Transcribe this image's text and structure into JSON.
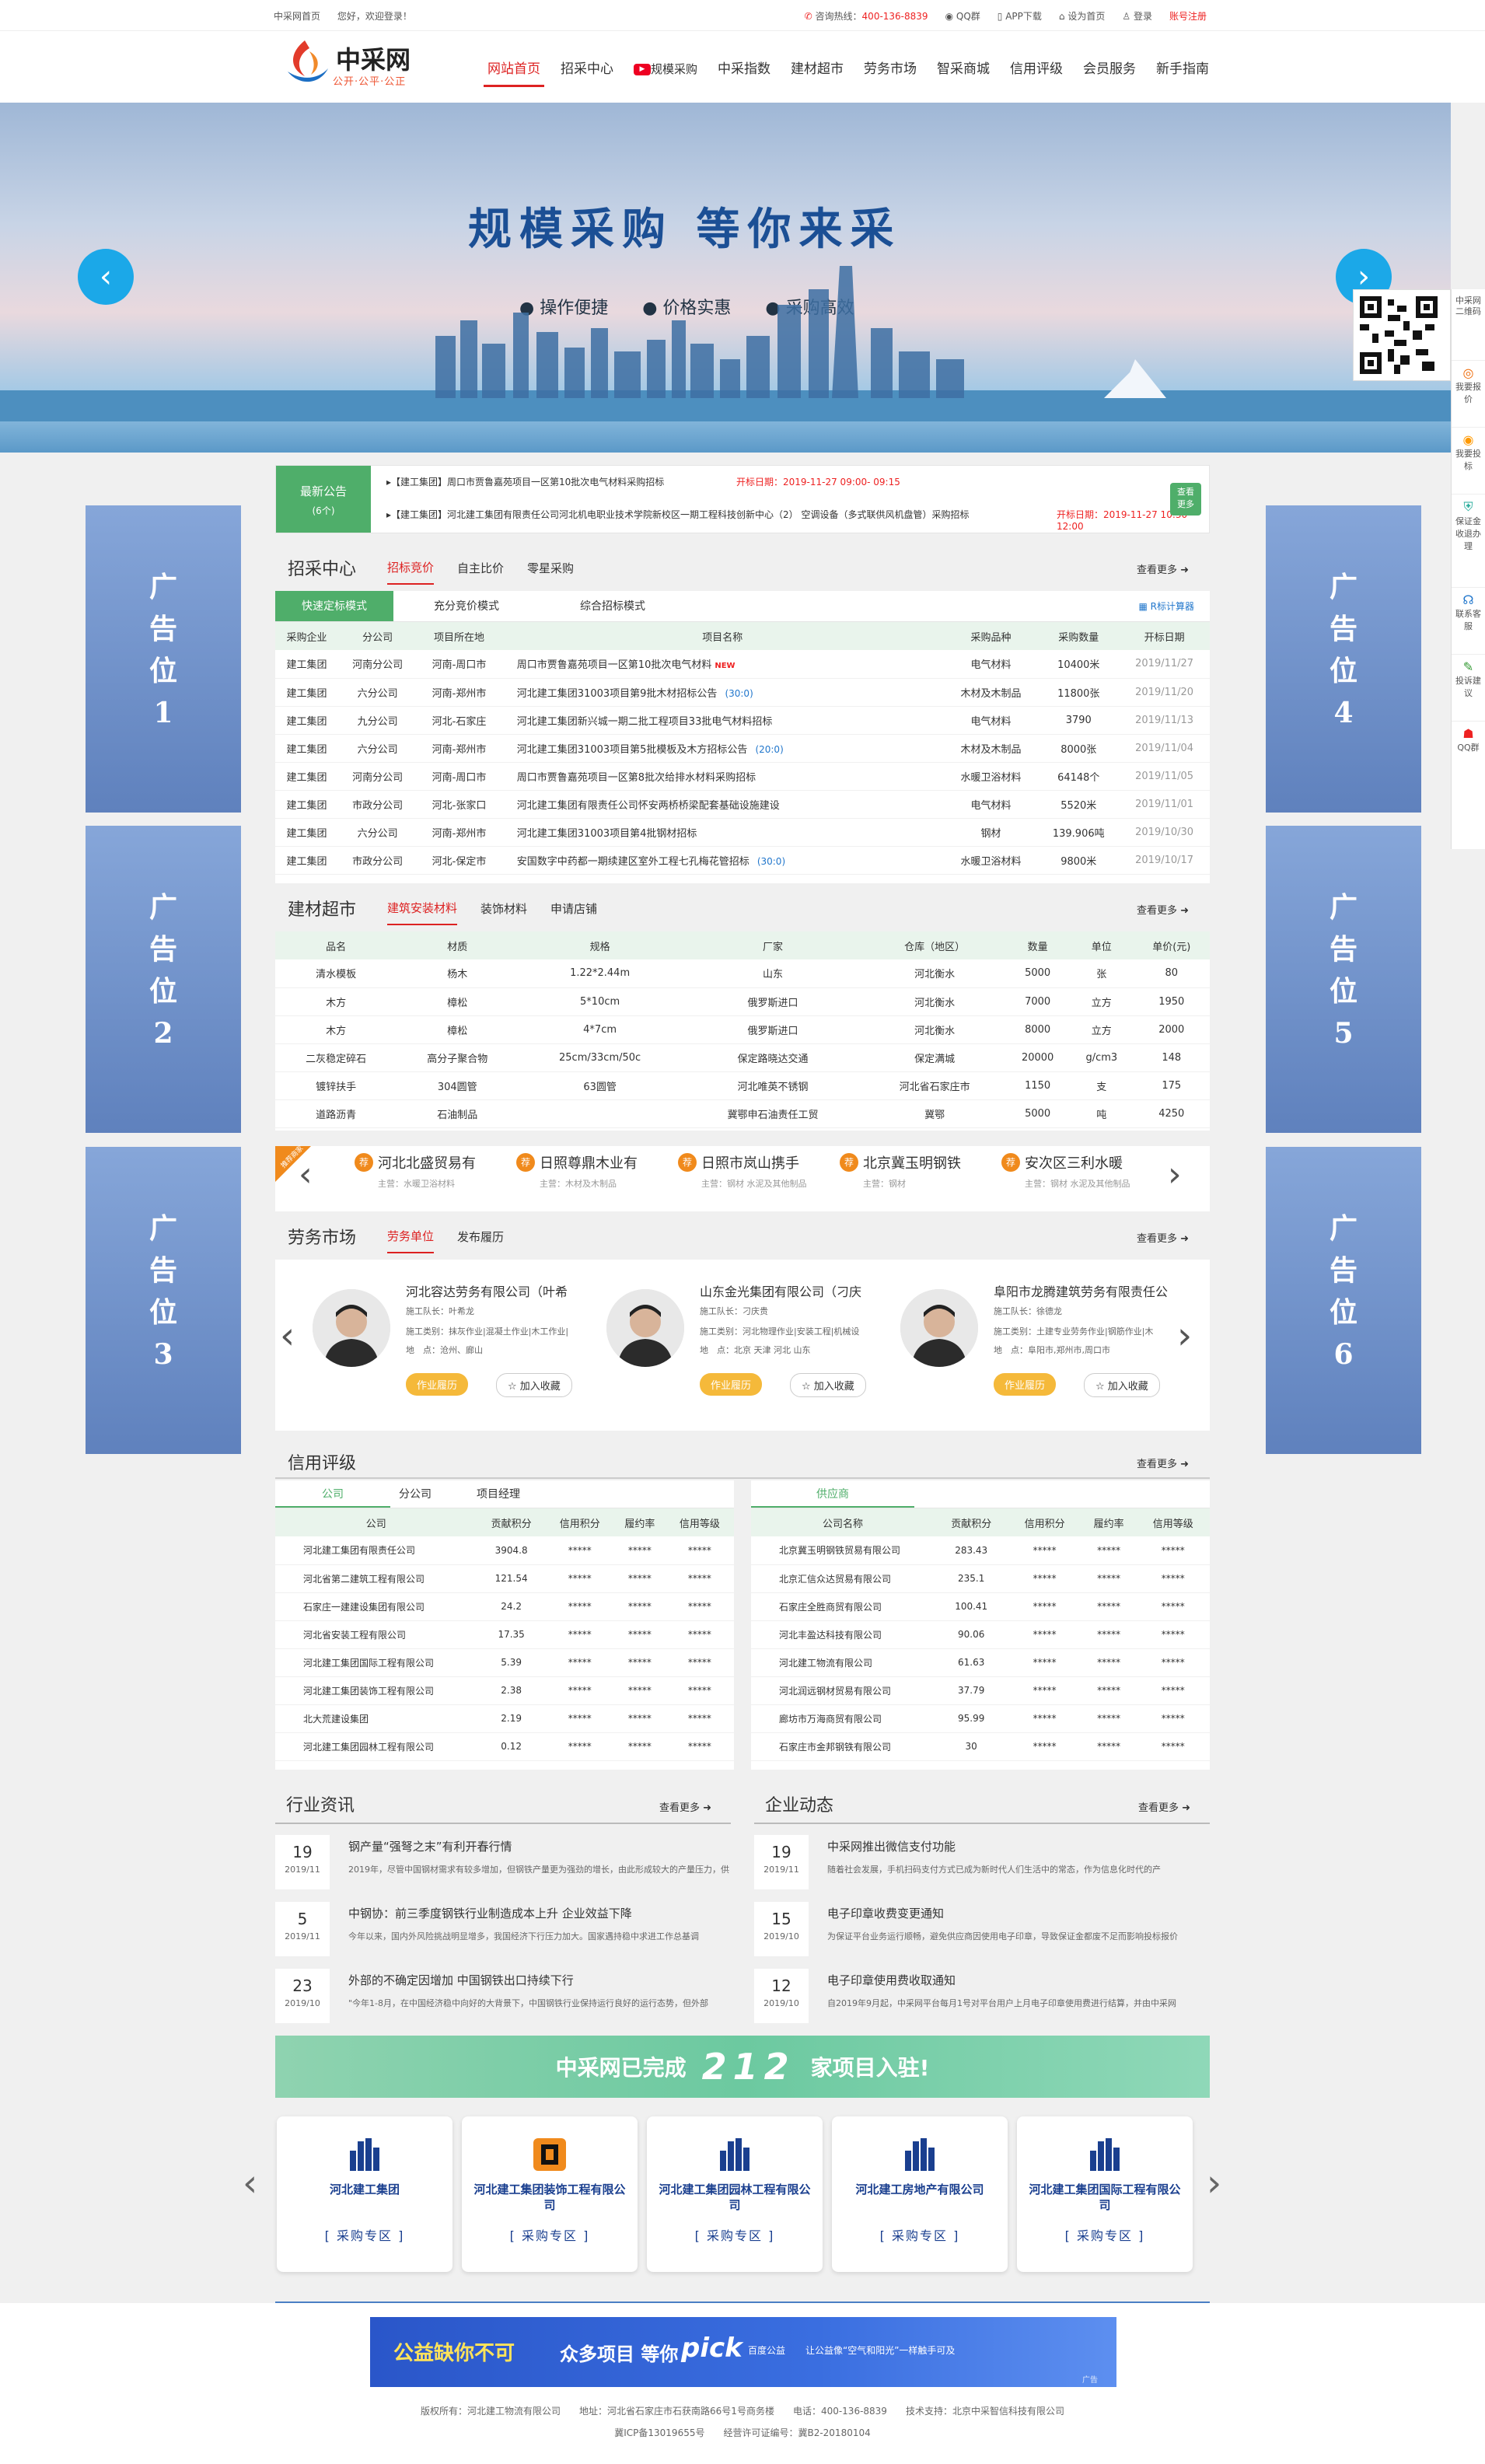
{
  "topbar": {
    "home": "中采网首页",
    "greeting": "您好，欢迎登录！",
    "hotline_label": "咨询热线：",
    "hotline": "400-136-8839",
    "qq": "QQ群",
    "app": "APP下载",
    "set_home": "设为首页",
    "login": "登录",
    "register": "账号注册"
  },
  "logo": {
    "title": "中采网",
    "slogan": "公开·公平·公正"
  },
  "nav": [
    "网站首页",
    "招采中心",
    "规模采购",
    "中采指数",
    "建材超市",
    "劳务市场",
    "智采商城",
    "信用评级",
    "会员服务",
    "新手指南"
  ],
  "banner": {
    "title": "规模采购 等你来采",
    "subs": [
      "● 操作便捷",
      "● 价格实惠",
      "● 采购高效"
    ]
  },
  "sidebar": [
    "中采网二维码",
    "我要报价",
    "我要投标",
    "保证金收退办理",
    "联系客服",
    "投诉建议",
    "QQ群"
  ],
  "notice": {
    "title": "最新公告",
    "count": "(6个)",
    "more": "查看更多",
    "items": [
      {
        "text": "▸【建工集团】周口市贾鲁嘉苑项目一区第10批次电气材料采购招标",
        "time": "开标日期：2019-11-27 09:00- 09:15"
      },
      {
        "text": "▸【建工集团】河北建工集团有限责任公司河北机电职业技术学院新校区一期工程科技创新中心（2） 空调设备（多式联供风机盘管）采购招标",
        "time": "开标日期：2019-11-27 10:30- 12:00"
      }
    ]
  },
  "ads": [
    "广告位1",
    "广告位2",
    "广告位3",
    "广告位4",
    "广告位5",
    "广告位6"
  ],
  "bid": {
    "title": "招采中心",
    "tabs": [
      "招标竞价",
      "自主比价",
      "零星采购"
    ],
    "more": "查看更多",
    "modes": [
      "快速定标模式",
      "充分竞价模式",
      "综合招标模式"
    ],
    "calc": "R标计算器",
    "headers": [
      "采购企业",
      "分公司",
      "项目所在地",
      "项目名称",
      "采购品种",
      "采购数量",
      "开标日期"
    ],
    "rows": [
      [
        "建工集团",
        "河南分公司",
        "河南-周口市",
        "周口市贾鲁嘉苑项目一区第10批次电气材料",
        "电气材料",
        "10400米",
        "2019/11/27"
      ],
      [
        "建工集团",
        "六分公司",
        "河南-郑州市",
        "河北建工集团31003项目第9批木材招标公告",
        "木材及木制品",
        "11800张",
        "2019/11/20"
      ],
      [
        "建工集团",
        "九分公司",
        "河北-石家庄",
        "河北建工集团新兴城一期二批工程项目33批电气材料招标",
        "电气材料",
        "3790",
        "2019/11/13"
      ],
      [
        "建工集团",
        "六分公司",
        "河南-郑州市",
        "河北建工集团31003项目第5批模板及木方招标公告",
        "木材及木制品",
        "8000张",
        "2019/11/04"
      ],
      [
        "建工集团",
        "河南分公司",
        "河南-周口市",
        "周口市贾鲁嘉苑项目一区第8批次给排水材料采购招标",
        "水暖卫浴材料",
        "64148个",
        "2019/11/05"
      ],
      [
        "建工集团",
        "市政分公司",
        "河北-张家口",
        "河北建工集团有限责任公司怀安两桥桥梁配套基础设施建设",
        "电气材料",
        "5520米",
        "2019/11/01"
      ],
      [
        "建工集团",
        "六分公司",
        "河南-郑州市",
        "河北建工集团31003项目第4批钢材招标",
        "钢材",
        "139.906吨",
        "2019/10/30"
      ],
      [
        "建工集团",
        "市政分公司",
        "河北-保定市",
        "安国数字中药都一期续建区室外工程七孔梅花管招标",
        "水暖卫浴材料",
        "9800米",
        "2019/10/17"
      ]
    ],
    "tags": [
      {
        "r": 1,
        "tag": "(30:0)"
      },
      {
        "r": 3,
        "tag": "(20:0)"
      },
      {
        "r": 7,
        "tag": "(30:0)"
      }
    ],
    "new_badge": "NEW"
  },
  "market": {
    "title": "建材超市",
    "tabs": [
      "建筑安装材料",
      "装饰材料",
      "申请店铺"
    ],
    "more": "查看更多",
    "headers": [
      "品名",
      "材质",
      "规格",
      "厂家",
      "仓库（地区）",
      "数量",
      "单位",
      "单价(元)"
    ],
    "rows": [
      [
        "清水模板",
        "杨木",
        "1.22*2.44m",
        "山东",
        "河北衡水",
        "5000",
        "张",
        "80"
      ],
      [
        "木方",
        "樟松",
        "5*10cm",
        "俄罗斯进口",
        "河北衡水",
        "7000",
        "立方",
        "1950"
      ],
      [
        "木方",
        "樟松",
        "4*7cm",
        "俄罗斯进口",
        "河北衡水",
        "8000",
        "立方",
        "2000"
      ],
      [
        "二灰稳定碎石",
        "高分子聚合物",
        "25cm/33cm/50c",
        "保定路晓达交通",
        "保定满城",
        "20000",
        "g/cm3",
        "148"
      ],
      [
        "镀锌扶手",
        "304圆管",
        "63圆管",
        "河北唯英不锈钢",
        "河北省石家庄市",
        "1150",
        "支",
        "175"
      ],
      [
        "道路沥青",
        "石油制品",
        "",
        "冀鄂申石油责任工贸",
        "冀鄂",
        "5000",
        "吨",
        "4250"
      ]
    ],
    "ribbon": "推荐商家",
    "shops": [
      {
        "name": "河北北盛贸易有",
        "main": "主营：水暖卫浴材料"
      },
      {
        "name": "日照尊鼎木业有",
        "main": "主营：木材及木制品"
      },
      {
        "name": "日照市岚山携手",
        "main": "主营：钢材 水泥及其他制品"
      },
      {
        "name": "北京冀玉明钢铁",
        "main": "主营：钢材"
      },
      {
        "name": "安次区三利水暖",
        "main": "主营：钢材 水泥及其他制品"
      }
    ],
    "shop_mark": "荐"
  },
  "labor": {
    "title": "劳务市场",
    "tabs": [
      "劳务单位",
      "发布履历"
    ],
    "more": "查看更多",
    "cards": [
      {
        "name": "河北容达劳务有限公司（叶希",
        "leader": "施工队长：叶希龙",
        "scope": "施工类别：抹灰作业|混凝土作业|木工作业|",
        "area": "地　点：沧州、廊山"
      },
      {
        "name": "山东金光集团有限公司（刁庆",
        "leader": "施工队长：刁庆贵",
        "scope": "施工类别：河北物理作业|安装工程|机械设",
        "area": "地　点：北京 天津 河北 山东"
      },
      {
        "name": "阜阳市龙腾建筑劳务有限责任公",
        "leader": "施工队长：徐德龙",
        "scope": "施工类别：土建专业劳务作业|钢筋作业|木",
        "area": "地　点：阜阳市,郑州市,周口市"
      }
    ],
    "btn_resume": "作业履历",
    "btn_fav": "☆ 加入收藏"
  },
  "credit": {
    "title": "信用评级",
    "more": "查看更多",
    "left_tabs": [
      "公司",
      "分公司",
      "项目经理"
    ],
    "right_tabs": [
      "供应商"
    ],
    "headers_l": [
      "公司",
      "贡献积分",
      "信用积分",
      "履约率",
      "信用等级"
    ],
    "headers_r": [
      "公司名称",
      "贡献积分",
      "信用积分",
      "履约率",
      "信用等级"
    ],
    "left": [
      [
        "河北建工集团有限责任公司",
        "3904.8"
      ],
      [
        "河北省第二建筑工程有限公司",
        "121.54"
      ],
      [
        "石家庄一建建设集团有限公司",
        "24.2"
      ],
      [
        "河北省安装工程有限公司",
        "17.35"
      ],
      [
        "河北建工集团国际工程有限公司",
        "5.39"
      ],
      [
        "河北建工集团装饰工程有限公司",
        "2.38"
      ],
      [
        "北大荒建设集团",
        "2.19"
      ],
      [
        "河北建工集团园林工程有限公司",
        "0.12"
      ]
    ],
    "right": [
      [
        "北京冀玉明钢铁贸易有限公司",
        "283.43"
      ],
      [
        "北京汇信众达贸易有限公司",
        "235.1"
      ],
      [
        "石家庄全胜商贸有限公司",
        "100.41"
      ],
      [
        "河北丰盈达科技有限公司",
        "90.06"
      ],
      [
        "河北建工物流有限公司",
        "61.63"
      ],
      [
        "河北润远钢材贸易有限公司",
        "37.79"
      ],
      [
        "廊坊市万海商贸有限公司",
        "95.99"
      ],
      [
        "石家庄市金邦钢铁有限公司",
        "30"
      ]
    ],
    "stars": "*****"
  },
  "news": {
    "industry": {
      "title": "行业资讯",
      "more": "查看更多",
      "items": [
        {
          "day": "19",
          "ym": "2019/11",
          "title": "钢产量“强弩之末”有利开春行情",
          "desc": "2019年，尽管中国钢材需求有较多增加，但钢铁产量更为强劲的增长，由此形成较大的产量压力，供应"
        },
        {
          "day": "5",
          "ym": "2019/11",
          "title": "中钢协：前三季度钢铁行业制造成本上升 企业效益下降",
          "desc": "今年以来，国内外风险挑战明显增多，我国经济下行压力加大。国家遇持稳中求进工作总基调"
        },
        {
          "day": "23",
          "ym": "2019/10",
          "title": "外部的不确定因增加 中国钢铁出口持续下行",
          "desc": "\"今年1-8月，在中国经济稳中向好的大背景下，中国钢铁行业保持运行良好的运行态势，但外部"
        }
      ]
    },
    "company": {
      "title": "企业动态",
      "more": "查看更多",
      "items": [
        {
          "day": "19",
          "ym": "2019/11",
          "title": "中采网推出微信支付功能",
          "desc": "随着社会发展，手机扫码支付方式已成为新时代人们生活中的常态，作为信息化时代的产"
        },
        {
          "day": "15",
          "ym": "2019/10",
          "title": "电子印章收费变更通知",
          "desc": "为保证平台业务运行顺畅，避免供应商因使用电子印章，导致保证金都废不足而影响投标报价"
        },
        {
          "day": "12",
          "ym": "2019/10",
          "title": "电子印章使用费收取通知",
          "desc": "自2019年9月起，中采网平台每月1号对平台用户上月电子印章使用费进行结算，并由中采网"
        }
      ]
    }
  },
  "stat": {
    "pre": "中采网已完成",
    "num": "212",
    "post": "家项目入驻!"
  },
  "partners": [
    {
      "name": "河北建工集团",
      "btn": "[ 采购专区 ]"
    },
    {
      "name": "河北建工集团装饰工程有限公司",
      "btn": "[ 采购专区 ]"
    },
    {
      "name": "河北建工集团园林工程有限公司",
      "btn": "[ 采购专区 ]"
    },
    {
      "name": "河北建工房地产有限公司",
      "btn": "[ 采购专区 ]"
    },
    {
      "name": "河北建工集团国际工程有限公司",
      "btn": "[ 采购专区 ]"
    }
  ],
  "pub": {
    "a": "公益缺你不可",
    "b": "众多项目 等你",
    "c": "pick",
    "d": "百度公益",
    "e": "让公益像“空气和阳光”一样触手可及",
    "f": "广告"
  },
  "footer": {
    "line1": "版权所有：河北建工物流有限公司　　地址：河北省石家庄市石获南路66号1号商务楼　　电话：400-136-8839　　技术支持：北京中采智信科技有限公司",
    "line2": "冀ICP备13019655号　　经营许可证编号：冀B2-20180104"
  },
  "colors": {
    "brand_red": "#dd2222",
    "green": "#4fae6a",
    "blue": "#1ba8e8",
    "ad_blue": "#6f90c9"
  }
}
